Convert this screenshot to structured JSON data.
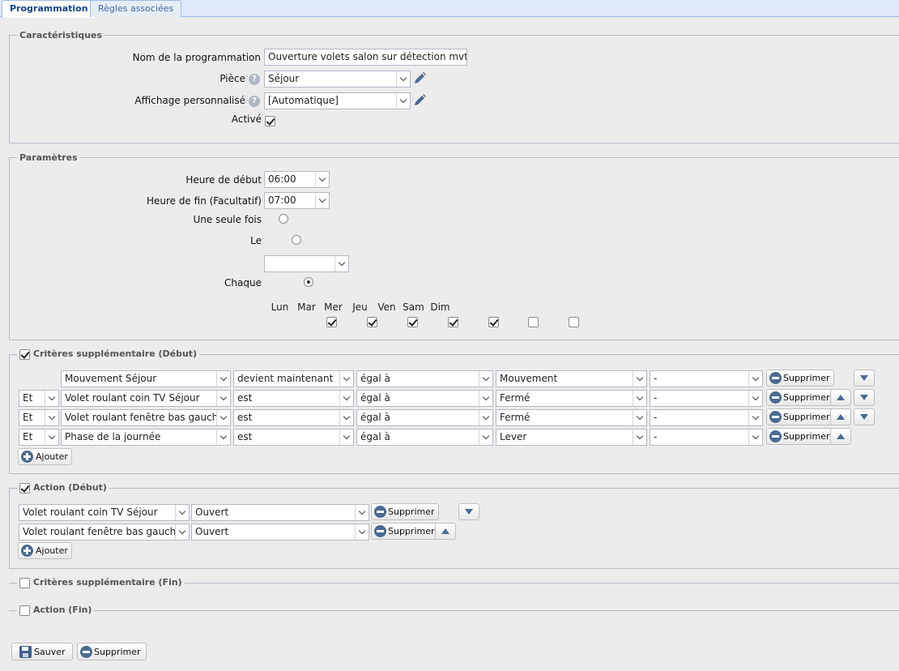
{
  "tabs": [
    "Programmation",
    "Règles associées"
  ],
  "caracteristiques": {
    "legend": "Caractéristiques",
    "nom_label": "Nom de la programmation",
    "nom_value": "Ouverture volets salon sur détection mvt",
    "piece_label": "Pièce",
    "piece_value": "Séjour",
    "affichage_label": "Affichage personnalisé",
    "affichage_value": "[Automatique]",
    "active_label": "Activé",
    "active_checked": true
  },
  "parametres": {
    "legend": "Paramètres",
    "debut_label": "Heure de début",
    "debut_value": "06:00",
    "fin_label": "Heure de fin (Facultatif)",
    "fin_value": "07:00",
    "une_fois_label": "Une seule fois",
    "le_label": "Le",
    "le_value": "",
    "chaque_label": "Chaque",
    "chaque_selected": true,
    "days": [
      {
        "label": "Lun",
        "checked": true
      },
      {
        "label": "Mar",
        "checked": true
      },
      {
        "label": "Mer",
        "checked": true
      },
      {
        "label": "Jeu",
        "checked": true
      },
      {
        "label": "Ven",
        "checked": true
      },
      {
        "label": "Sam",
        "checked": false
      },
      {
        "label": "Dim",
        "checked": false
      }
    ]
  },
  "criteres_debut": {
    "legend": "Critères supplémentaire (Début)",
    "checked": true,
    "rows": [
      {
        "connector": "",
        "device": "Mouvement Séjour",
        "condition": "devient maintenant",
        "operator": "égal à",
        "value": "Mouvement",
        "extra": "-"
      },
      {
        "connector": "Et",
        "device": "Volet roulant coin TV Séjour",
        "condition": "est",
        "operator": "égal à",
        "value": "Fermé",
        "extra": "-"
      },
      {
        "connector": "Et",
        "device": "Volet roulant fenêtre bas gauche S",
        "condition": "est",
        "operator": "égal à",
        "value": "Fermé",
        "extra": "-"
      },
      {
        "connector": "Et",
        "device": "Phase de la journée",
        "condition": "est",
        "operator": "égal à",
        "value": "Lever",
        "extra": "-"
      }
    ],
    "delete_label": "Supprimer",
    "add_label": "Ajouter"
  },
  "action_debut": {
    "legend": "Action (Début)",
    "checked": true,
    "rows": [
      {
        "device": "Volet roulant coin TV Séjour",
        "state": "Ouvert"
      },
      {
        "device": "Volet roulant fenêtre bas gauche S",
        "state": "Ouvert"
      }
    ],
    "delete_label": "Supprimer",
    "add_label": "Ajouter"
  },
  "criteres_fin": {
    "legend": "Critères supplémentaire (Fin)",
    "checked": false
  },
  "action_fin": {
    "legend": "Action (Fin)",
    "checked": false
  },
  "footer": {
    "save_label": "Sauver",
    "delete_label": "Supprimer"
  }
}
